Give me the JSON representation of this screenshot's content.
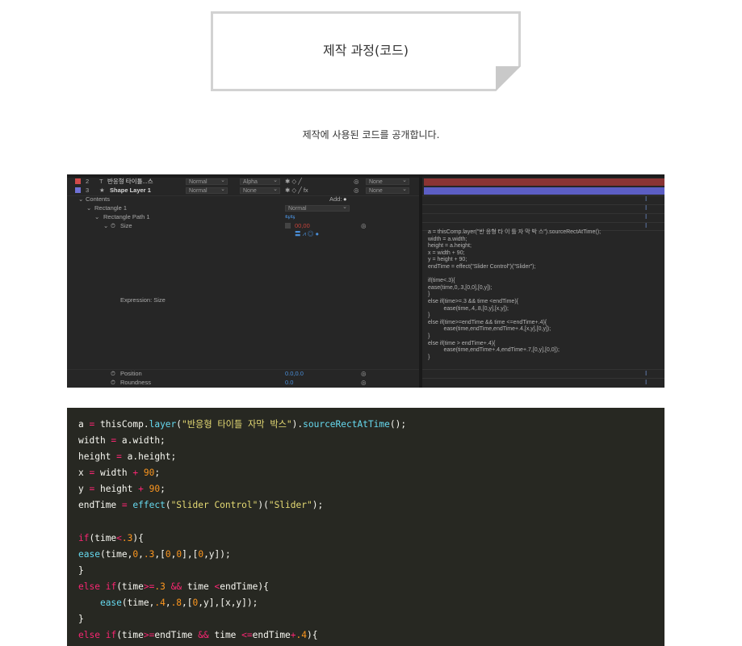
{
  "header": {
    "title": "제작 과정(코드)",
    "subtitle": "제작에 사용된 코드를 공개합니다."
  },
  "ae_screenshot": {
    "layers": [
      {
        "num": "2",
        "type_icon": "T",
        "name": "반응형 타이틀...스",
        "mode": "Normal",
        "trkmat": "Alpha",
        "parent": "None",
        "label_color": "#d04a4a",
        "bar_color": "#8a3434"
      },
      {
        "num": "3",
        "type_icon": "★",
        "name": "Shape Layer 1",
        "mode": "Normal",
        "trkmat": "None",
        "parent": "None",
        "label_color": "#6f71d6",
        "bar_color": "#5c5ec4"
      }
    ],
    "contents_label": "Contents",
    "add_label": "Add:",
    "rectangle_label": "Rectangle 1",
    "rectangle_mode": "Normal",
    "rect_path_label": "Rectangle Path 1",
    "size_label": "Size",
    "size_value": "00,00",
    "expression_label": "Expression: Size",
    "position_label": "Position",
    "position_value": "0.0,0.0",
    "roundness_label": "Roundness",
    "roundness_value": "0.0",
    "expression_text": "a = thisComp.layer(\"반 응형 타 이 틀 자 막 박 스\").sourceRectAtTime();\nwidth = a.width;\nheight = a.height;\nx = width + 90;\ny = height + 90;\nendTime = effect(\"Slider Control\")(\"Slider\");\n\nif(time<.3){\nease(time,0,.3,[0,0],[0,y]);\n}\nelse if(time>=.3 && time <endTime){\n          ease(time,.4,.8,[0,y],[x,y]);\n}\nelse if(time>=endTime && time <=endTime+.4){\n          ease(time,endTime,endTime+.4,[x,y],[0,y]);\n}\nelse if(time > endTime+.4){\n          ease(time,endTime+.4,endTime+.7,[0,y],[0,0]);\n}"
  },
  "code_block": {
    "lines": [
      [
        [
          "p",
          "a "
        ],
        [
          "o",
          "="
        ],
        [
          "p",
          " thisComp."
        ],
        [
          "f",
          "layer"
        ],
        [
          "p",
          "("
        ],
        [
          "s",
          "\"반응형 타이틀 자막 박스\""
        ],
        [
          "p",
          ")."
        ],
        [
          "f",
          "sourceRectAtTime"
        ],
        [
          "p",
          "();"
        ]
      ],
      [
        [
          "p",
          "width "
        ],
        [
          "o",
          "="
        ],
        [
          "p",
          " a.width;"
        ]
      ],
      [
        [
          "p",
          "height "
        ],
        [
          "o",
          "="
        ],
        [
          "p",
          " a.height;"
        ]
      ],
      [
        [
          "p",
          "x "
        ],
        [
          "o",
          "="
        ],
        [
          "p",
          " width "
        ],
        [
          "o",
          "+"
        ],
        [
          "p",
          " "
        ],
        [
          "n",
          "90"
        ],
        [
          "p",
          ";"
        ]
      ],
      [
        [
          "p",
          "y "
        ],
        [
          "o",
          "="
        ],
        [
          "p",
          " height "
        ],
        [
          "o",
          "+"
        ],
        [
          "p",
          " "
        ],
        [
          "n",
          "90"
        ],
        [
          "p",
          ";"
        ]
      ],
      [
        [
          "p",
          "endTime "
        ],
        [
          "o",
          "="
        ],
        [
          "p",
          " "
        ],
        [
          "f",
          "effect"
        ],
        [
          "p",
          "("
        ],
        [
          "s",
          "\"Slider Control\""
        ],
        [
          "p",
          ")("
        ],
        [
          "s",
          "\"Slider\""
        ],
        [
          "p",
          ");"
        ]
      ],
      [],
      [
        [
          "k",
          "if"
        ],
        [
          "p",
          "(time"
        ],
        [
          "o",
          "<"
        ],
        [
          "n",
          ".3"
        ],
        [
          "p",
          "){"
        ]
      ],
      [
        [
          "f",
          "ease"
        ],
        [
          "p",
          "(time,"
        ],
        [
          "n",
          "0"
        ],
        [
          "p",
          ","
        ],
        [
          "n",
          ".3"
        ],
        [
          "p",
          ",["
        ],
        [
          "n",
          "0"
        ],
        [
          "p",
          ","
        ],
        [
          "n",
          "0"
        ],
        [
          "p",
          "],["
        ],
        [
          "n",
          "0"
        ],
        [
          "p",
          ",y]);"
        ]
      ],
      [
        [
          "p",
          "}"
        ]
      ],
      [
        [
          "k",
          "else"
        ],
        [
          "p",
          " "
        ],
        [
          "k",
          "if"
        ],
        [
          "p",
          "(time"
        ],
        [
          "o",
          ">="
        ],
        [
          "n",
          ".3"
        ],
        [
          "p",
          " "
        ],
        [
          "o",
          "&&"
        ],
        [
          "p",
          " time "
        ],
        [
          "o",
          "<"
        ],
        [
          "p",
          "endTime){"
        ]
      ],
      [
        [
          "p",
          "    "
        ],
        [
          "f",
          "ease"
        ],
        [
          "p",
          "(time,"
        ],
        [
          "n",
          ".4"
        ],
        [
          "p",
          ","
        ],
        [
          "n",
          ".8"
        ],
        [
          "p",
          ",["
        ],
        [
          "n",
          "0"
        ],
        [
          "p",
          ",y],[x,y]);"
        ]
      ],
      [
        [
          "p",
          "}"
        ]
      ],
      [
        [
          "k",
          "else"
        ],
        [
          "p",
          " "
        ],
        [
          "k",
          "if"
        ],
        [
          "p",
          "(time"
        ],
        [
          "o",
          ">="
        ],
        [
          "p",
          "endTime "
        ],
        [
          "o",
          "&&"
        ],
        [
          "p",
          " time "
        ],
        [
          "o",
          "<="
        ],
        [
          "p",
          "endTime"
        ],
        [
          "o",
          "+"
        ],
        [
          "n",
          ".4"
        ],
        [
          "p",
          "){"
        ]
      ]
    ]
  },
  "colors": {
    "code_bg": "#272822",
    "ae_bg": "#262626",
    "card_border": "#d2d2d2"
  }
}
